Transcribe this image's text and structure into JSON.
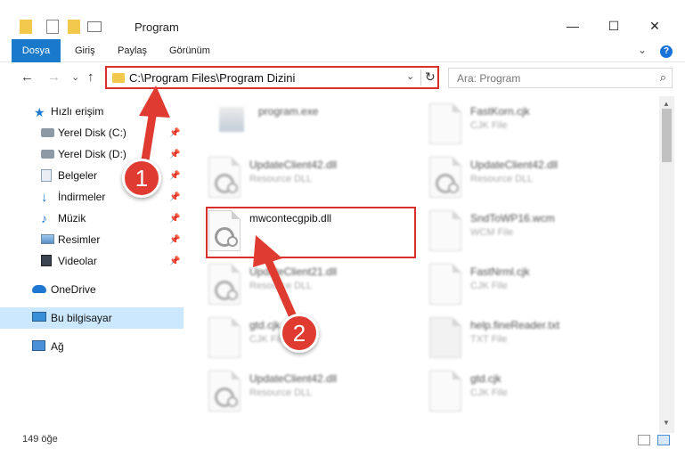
{
  "window": {
    "title": "Program",
    "minimize": "—",
    "maximize": "☐",
    "close": "✕"
  },
  "ribbon": {
    "tabs": [
      "Dosya",
      "Giriş",
      "Paylaş",
      "Görünüm"
    ],
    "help": "?",
    "collapse": "⌄"
  },
  "nav": {
    "back": "←",
    "forward": "→",
    "recent": "⌄",
    "up": "↑"
  },
  "address": {
    "path": "C:\\Program Files\\Program Dizini",
    "dropdown": "⌄",
    "refresh": "↻"
  },
  "search": {
    "placeholder": "Ara: Program",
    "icon": "⌕"
  },
  "sidebar": {
    "items": [
      {
        "label": "Hızlı erişim",
        "icon": "star-icon",
        "pinned": false,
        "selected": false
      },
      {
        "label": "Yerel Disk (C:)",
        "icon": "drive-icon",
        "pinned": true,
        "selected": false
      },
      {
        "label": "Yerel Disk (D:)",
        "icon": "drive-icon",
        "pinned": true,
        "selected": false
      },
      {
        "label": "Belgeler",
        "icon": "documents-icon",
        "pinned": true,
        "selected": false
      },
      {
        "label": "İndirmeler",
        "icon": "download-icon",
        "pinned": true,
        "selected": false
      },
      {
        "label": "Müzik",
        "icon": "music-icon",
        "pinned": true,
        "selected": false
      },
      {
        "label": "Resimler",
        "icon": "pictures-icon",
        "pinned": true,
        "selected": false
      },
      {
        "label": "Videolar",
        "icon": "videos-icon",
        "pinned": true,
        "selected": false
      },
      {
        "label": "OneDrive",
        "icon": "cloud-icon",
        "pinned": false,
        "selected": false
      },
      {
        "label": "Bu bilgisayar",
        "icon": "computer-icon",
        "pinned": false,
        "selected": true
      },
      {
        "label": "Ağ",
        "icon": "network-icon",
        "pinned": false,
        "selected": false
      }
    ],
    "pin_glyph": "📌"
  },
  "files": [
    {
      "name": "program.exe",
      "type": ""
    },
    {
      "name": "FastKorn.cjk",
      "type": "CJK File"
    },
    {
      "name": "UpdateClient42.dll",
      "type": "Resource DLL"
    },
    {
      "name": "UpdateClient42.dll",
      "type": "Resource DLL"
    },
    {
      "name": "mwcontecgpib.dll",
      "type": ""
    },
    {
      "name": "SndToWP16.wcm",
      "type": "WCM File"
    },
    {
      "name": "UpdateClient21.dll",
      "type": "Resource DLL"
    },
    {
      "name": "FastNrml.cjk",
      "type": "CJK File"
    },
    {
      "name": "gtd.cjk",
      "type": "CJK File"
    },
    {
      "name": "help.fineReader.txt",
      "type": "TXT File"
    },
    {
      "name": "UpdateClient42.dll",
      "type": "Resource DLL"
    },
    {
      "name": "gtd.cjk",
      "type": "CJK File"
    }
  ],
  "status": {
    "item_count": "149 öğe"
  },
  "callouts": [
    "1",
    "2"
  ]
}
